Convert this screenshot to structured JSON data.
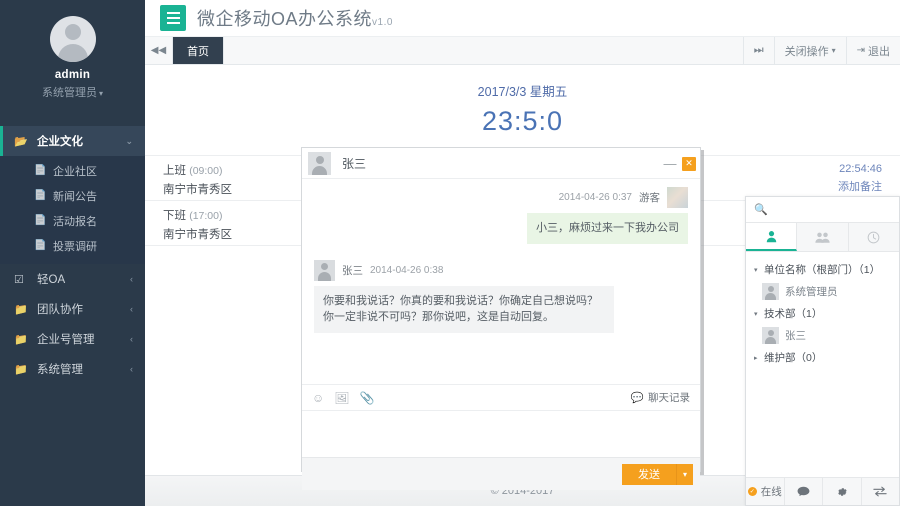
{
  "sidebar": {
    "profile": {
      "name": "admin",
      "role": "系统管理员",
      "caret": "▾",
      "avatar_icon": "user-avatar"
    },
    "groups": [
      {
        "label": "企业文化",
        "icon": "folder-open-icon",
        "arrow": "⌄",
        "active": true,
        "items": [
          {
            "label": "企业社区",
            "icon": "file-icon"
          },
          {
            "label": "新闻公告",
            "icon": "file-icon"
          },
          {
            "label": "活动报名",
            "icon": "file-icon"
          },
          {
            "label": "投票调研",
            "icon": "file-icon"
          }
        ]
      },
      {
        "label": "轻OA",
        "icon": "edit-square-icon",
        "arrow": "‹",
        "active": false,
        "items": []
      },
      {
        "label": "团队协作",
        "icon": "folder-icon",
        "arrow": "‹",
        "active": false,
        "items": []
      },
      {
        "label": "企业号管理",
        "icon": "folder-icon",
        "arrow": "‹",
        "active": false,
        "items": []
      },
      {
        "label": "系统管理",
        "icon": "folder-icon",
        "arrow": "‹",
        "active": false,
        "items": []
      }
    ]
  },
  "topbar": {
    "menu_icon": "hamburger-icon",
    "title": "微企移动OA办公系统",
    "version": "v1.0",
    "accent_color": "#1ab394"
  },
  "tabbar": {
    "collapse_icon": "◀◀",
    "tabs": [
      {
        "label": "首页",
        "active": true
      }
    ],
    "right_buttons": [
      {
        "label": "",
        "icon": "forward-icon"
      },
      {
        "label": "关闭操作",
        "icon": "caret-down-icon"
      },
      {
        "label": "退出",
        "icon": "logout-icon"
      }
    ]
  },
  "main": {
    "date": "2017/3/3  星期五",
    "time": "23:5:0",
    "attendance": [
      {
        "label": "上班",
        "time_range": "(09:00)",
        "place": "南宁市青秀区",
        "stamp": "22:54:46",
        "note": "添加备注"
      },
      {
        "label": "下班",
        "time_range": "(17:00)",
        "place": "南宁市青秀区",
        "stamp": "",
        "note": ""
      }
    ]
  },
  "footer": {
    "copyright": "© 2014-2017"
  },
  "chat_window": {
    "title": "张三",
    "minimize_icon": "minimize-icon",
    "close_icon": "close-icon",
    "messages": [
      {
        "side": "right",
        "sender": "游客",
        "timestamp": "2014-04-26 0:37",
        "text": "小三，麻烦过来一下我办公司",
        "bubble": "green"
      },
      {
        "side": "left",
        "sender": "张三",
        "timestamp": "2014-04-26 0:38",
        "text": "你要和我说话？你真的要和我说话？你确定自己想说吗？你一定非说不可吗？那你说吧，这是自动回复。",
        "bubble": "gray"
      }
    ],
    "tools": [
      {
        "icon": "emoji-icon",
        "glyph": "☺"
      },
      {
        "icon": "image-icon",
        "glyph": "🖼"
      },
      {
        "icon": "paperclip-icon",
        "glyph": "📎"
      }
    ],
    "history_label": "聊天记录",
    "history_icon": "comment-icon",
    "input_value": "",
    "input_placeholder": "",
    "send_label": "发送",
    "send_caret": "▾",
    "send_color": "#f5a01e"
  },
  "contact_panel": {
    "search_value": "",
    "search_placeholder": "",
    "search_icon": "search-icon",
    "tabs": [
      {
        "icon": "person-icon",
        "glyph": "P",
        "active": true
      },
      {
        "icon": "group-icon",
        "glyph": "G",
        "active": false
      },
      {
        "icon": "clock-icon",
        "glyph": "O",
        "active": false
      }
    ],
    "tree": [
      {
        "type": "dept",
        "label": "单位名称（根部门）（1）",
        "expanded": true,
        "tri": "▾",
        "members": [
          {
            "name": "系统管理员"
          }
        ]
      },
      {
        "type": "dept",
        "label": "技术部（1）",
        "expanded": true,
        "tri": "▾",
        "members": [
          {
            "name": "张三"
          }
        ]
      },
      {
        "type": "dept",
        "label": "维护部（0）",
        "expanded": false,
        "tri": "▸",
        "members": []
      }
    ],
    "footer": {
      "status_label": "在线",
      "status_icon": "status-online-icon",
      "status_color": "#f5a01e",
      "buttons": [
        {
          "icon": "chat-bubble-icon",
          "glyph": "💬"
        },
        {
          "icon": "gear-icon",
          "glyph": "⚙"
        },
        {
          "icon": "switch-icon",
          "glyph": "⇄"
        }
      ]
    }
  }
}
